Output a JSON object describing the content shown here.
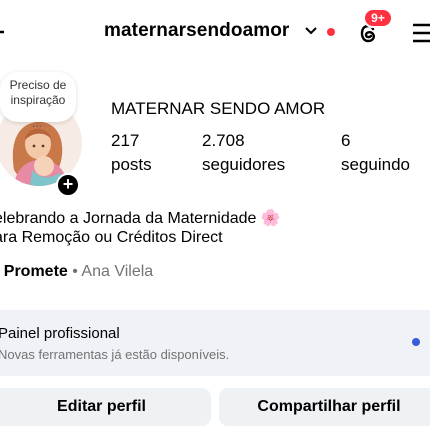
{
  "header": {
    "username": "maternarsendoamor",
    "notification_badge": "9+",
    "accent_red": "#ff3040"
  },
  "note": {
    "text_line1": "Preciso de",
    "text_line2": "inspiração",
    "ellipsis": "..."
  },
  "profile": {
    "display_name": "MATERNAR SENDO AMOR",
    "stats": [
      {
        "value": "217",
        "label": "posts"
      },
      {
        "value": "2.708",
        "label": "seguidores"
      },
      {
        "value": "6",
        "label": "seguindo"
      }
    ],
    "bio_line1": "elebrando a Jornada da Maternidade 🌸",
    "bio_line2": "ara Remoção ou Créditos Direct",
    "promote_label": ") Promete",
    "promote_separator": " • ",
    "promote_name": "Ana Vilela"
  },
  "professional_panel": {
    "title": "Painel profissional",
    "subtitle": "Novas ferramentas já estão disponíveis.",
    "dot_color": "#3b5bdb"
  },
  "buttons": {
    "edit_profile": "Editar perfil",
    "share_profile": "Compartilhar perfil"
  },
  "add_symbol": "+"
}
